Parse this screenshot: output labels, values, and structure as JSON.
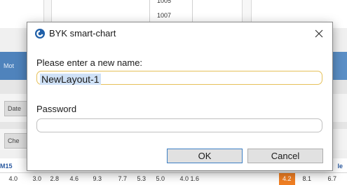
{
  "background": {
    "list_items": [
      "1005",
      "1007"
    ],
    "sidebar_label": "Mot",
    "buttons": [
      "Date",
      "Che"
    ],
    "table_header_left": "M15",
    "table_header_right": "le",
    "row_values": [
      "4.0",
      "3.0",
      "2.8",
      "4.6",
      "9.3",
      "7.7",
      "5.3",
      "5.0",
      "4.0",
      "1.6",
      "4.2",
      "8.1",
      "6.7"
    ],
    "highlight_color": "#f07f23"
  },
  "dialog": {
    "title": "BYK smart-chart",
    "app_icon": "byk-logo-icon",
    "close_icon": "close-icon",
    "name_label": "Please enter a new name:",
    "name_value": "NewLayout-1",
    "password_label": "Password",
    "password_value": "",
    "ok_label": "OK",
    "cancel_label": "Cancel"
  }
}
